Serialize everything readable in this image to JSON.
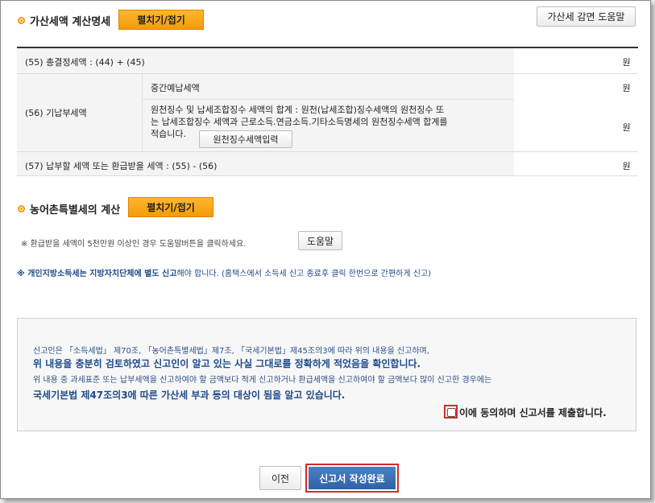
{
  "header": {
    "penalty_title": "가산세액 계산명세",
    "toggle_label": "펼치기/접기",
    "help_penalty_label": "가산세 감면 도움말"
  },
  "table": {
    "row55": {
      "label": "(55) 총결정세액 : (44) + (45)",
      "unit": "원"
    },
    "row56": {
      "label": "(56) 기납부세액",
      "sub1": "중간예납세액",
      "sub1_unit": "원",
      "sub2_line1": "원천징수 및 납세조합징수 세액의 합계 : 원천(납세조합)징수세액의 원천징수 또",
      "sub2_line2": "는 납세조합징수 세액과 근로소득.연금소득.기타소득명세의 원천징수세액 합계를",
      "sub2_line3": "적습니다.",
      "input_button": "원천징수세액입력",
      "sub2_unit": "원"
    },
    "row57": {
      "label": "(57) 납부할 세액 또는 환급받을 세액 : (55) - (56)",
      "unit": "원"
    }
  },
  "rural": {
    "title": "농어촌특별세의 계산",
    "toggle_label": "펼치기/접기",
    "note": "※ 환급받을 세액이 5천만원 이상인 경우 도움말버튼을 클릭하세요.",
    "help_label": "도움말"
  },
  "local_note": {
    "bold": "※ 개인지방소득세는 지방자치단체에 별도 신고",
    "rest": "해야 합니다. (홈택스에서 소득세 신고 종료후 클릭 한번으로 간편하게 신고)"
  },
  "declaration": {
    "line1": "신고인은 「소득세법」 제70조, 「농어촌특별세법」제7조, 「국세기본법」제45조의3에 따라 위의 내용을 신고하며,",
    "line2": "위 내용을 충분히 검토하였고 신고인이 알고 있는 사실 그대로를 정확하게 적었음을 확인합니다.",
    "line3": "위 내용 중 과세표준 또는 납부세액을 신고하여야 할 금액보다 적게 신고하거나 환급세액을 신고하여야 할 금액보다 많이 신고한 경우에는",
    "line4": "국세기본법 제47조의3에 따른 가산세 부과 등의 대상이 됨을 알고 있습니다.",
    "agree_label": "이에 동의하며 신고서를 제출합니다."
  },
  "footer": {
    "prev_label": "이전",
    "submit_label": "신고서 작성완료"
  },
  "colors": {
    "accent": "#f39a12",
    "submit": "#3a6fb4",
    "note_blue": "#1e4a8a"
  }
}
